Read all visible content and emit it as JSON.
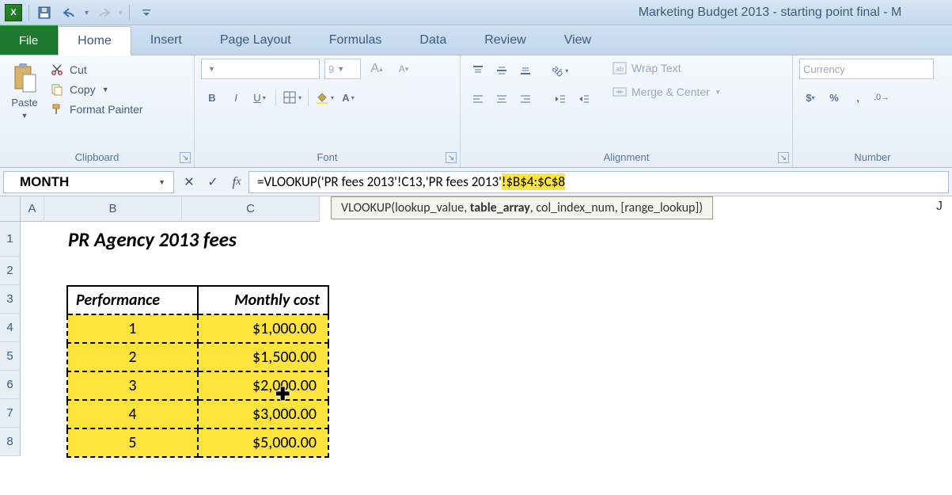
{
  "window_title": "Marketing Budget 2013 - starting point final - M",
  "tabs": {
    "file": "File",
    "list": [
      "Home",
      "Insert",
      "Page Layout",
      "Formulas",
      "Data",
      "Review",
      "View"
    ],
    "active": "Home"
  },
  "ribbon": {
    "clipboard": {
      "label": "Clipboard",
      "paste": "Paste",
      "cut": "Cut",
      "copy": "Copy",
      "painter": "Format Painter"
    },
    "font": {
      "label": "Font",
      "size": "9"
    },
    "alignment": {
      "label": "Alignment",
      "wrap": "Wrap Text",
      "merge": "Merge & Center"
    },
    "number": {
      "label": "Number",
      "format": "Currency"
    }
  },
  "namebox": "MONTH",
  "formula": {
    "prefix": "=VLOOKUP('PR fees 2013'!C13,'PR fees 2013'",
    "highlight": "!$B$4:$C$8"
  },
  "fn_tooltip": {
    "fn": "VLOOKUP",
    "sig_before": "(lookup_value, ",
    "sig_bold": "table_array",
    "sig_after": ", col_index_num, [range_lookup])"
  },
  "col_letters": [
    "A",
    "B",
    "C",
    "J"
  ],
  "row_numbers": [
    "1",
    "2",
    "3",
    "4",
    "5",
    "6",
    "7",
    "8"
  ],
  "sheet": {
    "title": "PR Agency 2013 fees",
    "headers": [
      "Performance",
      "Monthly cost"
    ],
    "rows": [
      {
        "perf": "1",
        "cost": "$1,000.00"
      },
      {
        "perf": "2",
        "cost": "$1,500.00"
      },
      {
        "perf": "3",
        "cost": "$2,000.00"
      },
      {
        "perf": "4",
        "cost": "$3,000.00"
      },
      {
        "perf": "5",
        "cost": "$5,000.00"
      }
    ]
  },
  "chart_data": {
    "type": "table",
    "title": "PR Agency 2013 fees",
    "columns": [
      "Performance",
      "Monthly cost"
    ],
    "rows": [
      [
        1,
        1000.0
      ],
      [
        2,
        1500.0
      ],
      [
        3,
        2000.0
      ],
      [
        4,
        3000.0
      ],
      [
        5,
        5000.0
      ]
    ],
    "currency": "USD"
  }
}
